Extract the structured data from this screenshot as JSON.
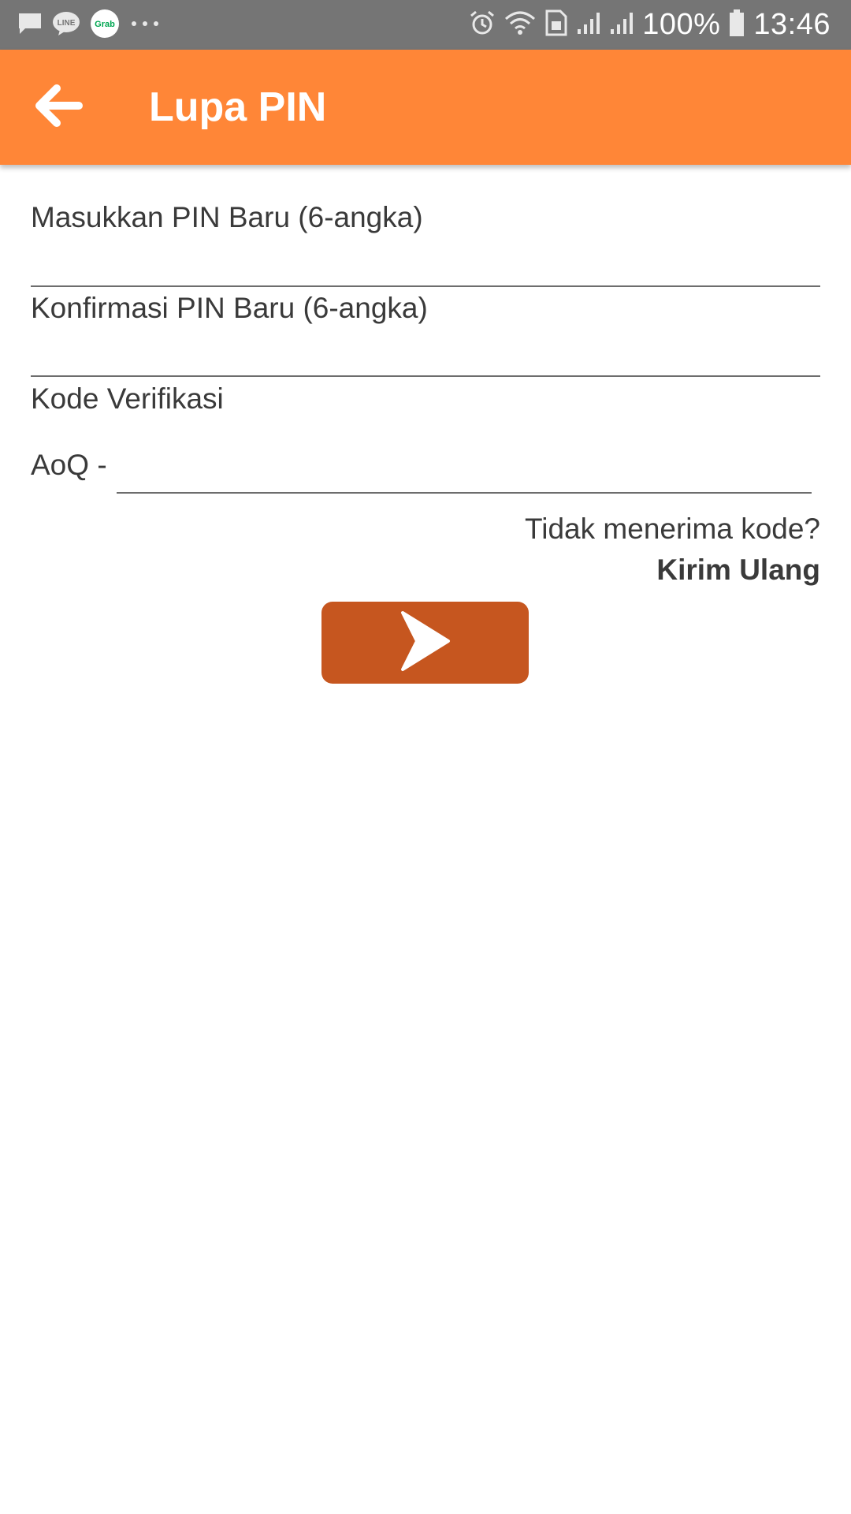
{
  "status_bar": {
    "left_icons": [
      "message-icon",
      "line-app-icon",
      "grab-app-icon",
      "more-dots-icon"
    ],
    "line_icon_text": "LINE",
    "grab_icon_text": "Grab",
    "right_icons": [
      "alarm-icon",
      "wifi-icon",
      "sim-icon",
      "signal-icon",
      "signal-icon",
      "battery-icon"
    ],
    "battery_text": "100%",
    "time": "13:46"
  },
  "appbar": {
    "title": "Lupa PIN",
    "back_icon": "arrow-left-icon",
    "color": "#ff8637"
  },
  "form": {
    "new_pin_label": "Masukkan PIN Baru (6-angka)",
    "confirm_pin_label": "Konfirmasi PIN Baru (6-angka)",
    "verification_label": "Kode Verifikasi",
    "verification_prefix": "AoQ -",
    "new_pin_value": "",
    "confirm_pin_value": "",
    "verification_value": ""
  },
  "resend": {
    "question": "Tidak menerima kode?",
    "action": "Kirim Ulang"
  },
  "submit": {
    "icon": "chevron-right-icon",
    "color": "#c6561f"
  }
}
